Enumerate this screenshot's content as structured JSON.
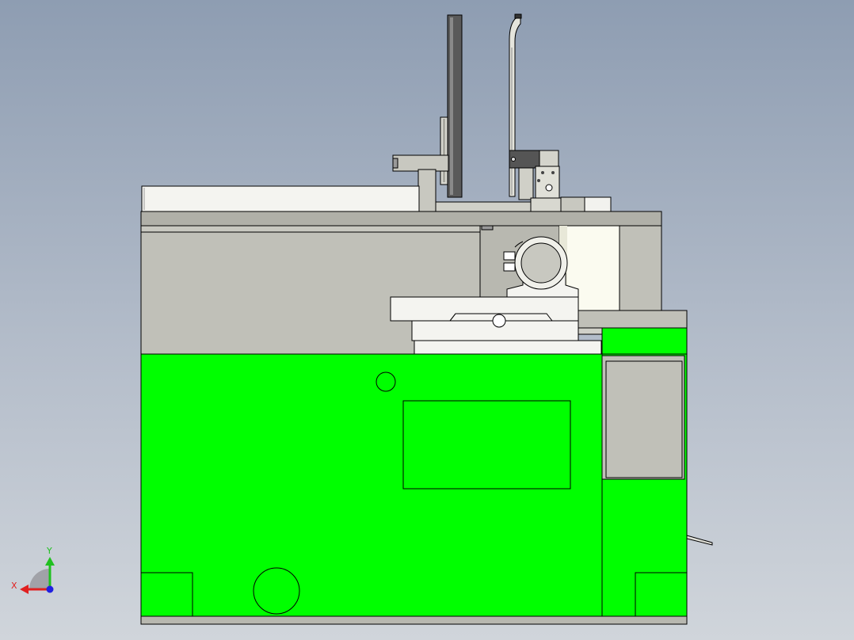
{
  "viewport": {
    "background_top": "#8e9db2",
    "background_bottom": "#d0d5db"
  },
  "colors": {
    "body_green": "#00ff00",
    "panel_gray": "#c0c0b8",
    "part_gray": "#b8b8b0",
    "light_part": "#f4f4f0",
    "dark_part": "#555555",
    "edge": "#000000"
  },
  "triad": {
    "x_label": "X",
    "y_label": "Y",
    "x_color": "#e02020",
    "y_color": "#20c020",
    "z_color": "#2020e0",
    "icon": "coordinate-triad-icon"
  }
}
